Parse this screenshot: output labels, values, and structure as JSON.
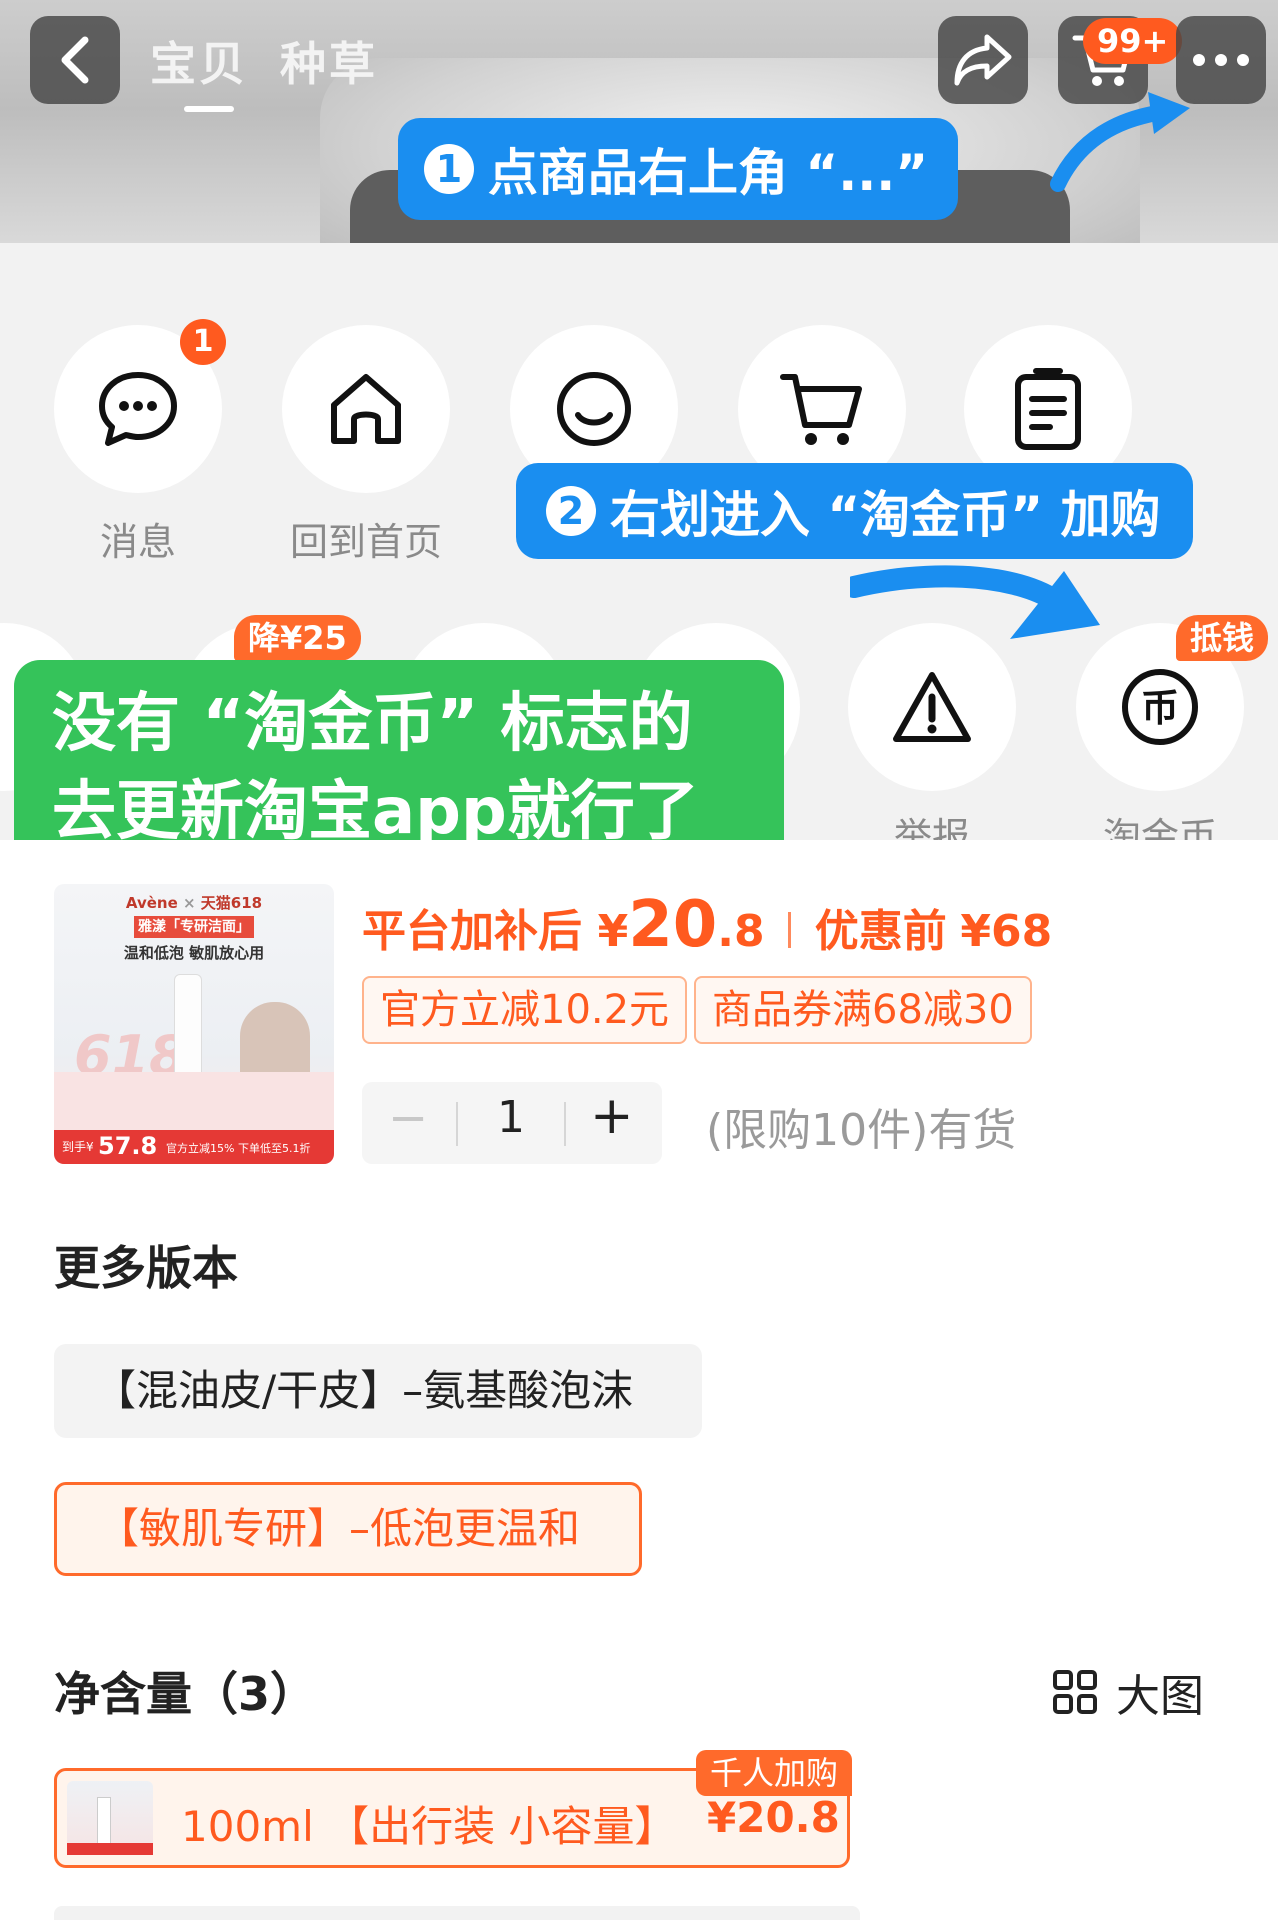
{
  "header": {
    "tabs": [
      {
        "label": "宝贝",
        "active": true
      },
      {
        "label": "种草",
        "active": false
      }
    ],
    "cart_badge": "99+"
  },
  "tips": {
    "step1_num": "1",
    "step1": "点商品右上角 “...”",
    "step2_num": "2",
    "step2": "右划进入 “淘金币” 加购"
  },
  "share_panel": {
    "row1": [
      {
        "icon": "chat-bubble-icon",
        "label": "消息",
        "badge": "1"
      },
      {
        "icon": "home-icon",
        "label": "回到首页"
      },
      {
        "icon": "smile-icon",
        "label": ""
      },
      {
        "icon": "cart-icon",
        "label": ""
      },
      {
        "icon": "clipboard-icon",
        "label": ""
      }
    ],
    "row2": [
      {
        "icon": "warning-icon",
        "label": "举报"
      },
      {
        "icon": "coin-icon",
        "label": "淘金币",
        "tag": "抵钱"
      }
    ],
    "price_drop_tag": "降¥25",
    "green_note": [
      "没有 “淘金币” 标志的",
      "去更新淘宝app就行了"
    ]
  },
  "product": {
    "thumb": {
      "brand": "Avène",
      "event": "天猫618",
      "line1": "雅漾「专研洁面」",
      "line2": "温和低泡 敏肌放心用",
      "big": "618",
      "price_prefix": "到手¥",
      "price": "57.8",
      "footer": "官方立减15% 下单低至5.1折"
    },
    "price_label": "平台加补后",
    "currency": "¥",
    "price_int": "20",
    "price_dec": ".8",
    "orig_label": "优惠前",
    "orig_price": "¥68",
    "coupons": [
      "官方立减10.2元",
      "商品券满68减30"
    ],
    "qty_minus": "−",
    "qty": "1",
    "qty_plus": "+",
    "stock": "(限购10件)有货"
  },
  "versions": {
    "title": "更多版本",
    "items": [
      {
        "label": "【混油皮/干皮】–氨基酸泡沫",
        "selected": false
      },
      {
        "label": "【敏肌专研】–低泡更温和",
        "selected": true
      }
    ]
  },
  "net_content": {
    "title": "净含量（3）",
    "view_label": "大图",
    "items": [
      {
        "label": "100ml 【出行装 小容量】",
        "price": "¥20.8",
        "tag": "千人加购",
        "selected": true
      }
    ]
  },
  "colors": {
    "accent": "#ff5a1f",
    "tip_blue": "#1a8ef0",
    "note_green": "#35c35a"
  }
}
